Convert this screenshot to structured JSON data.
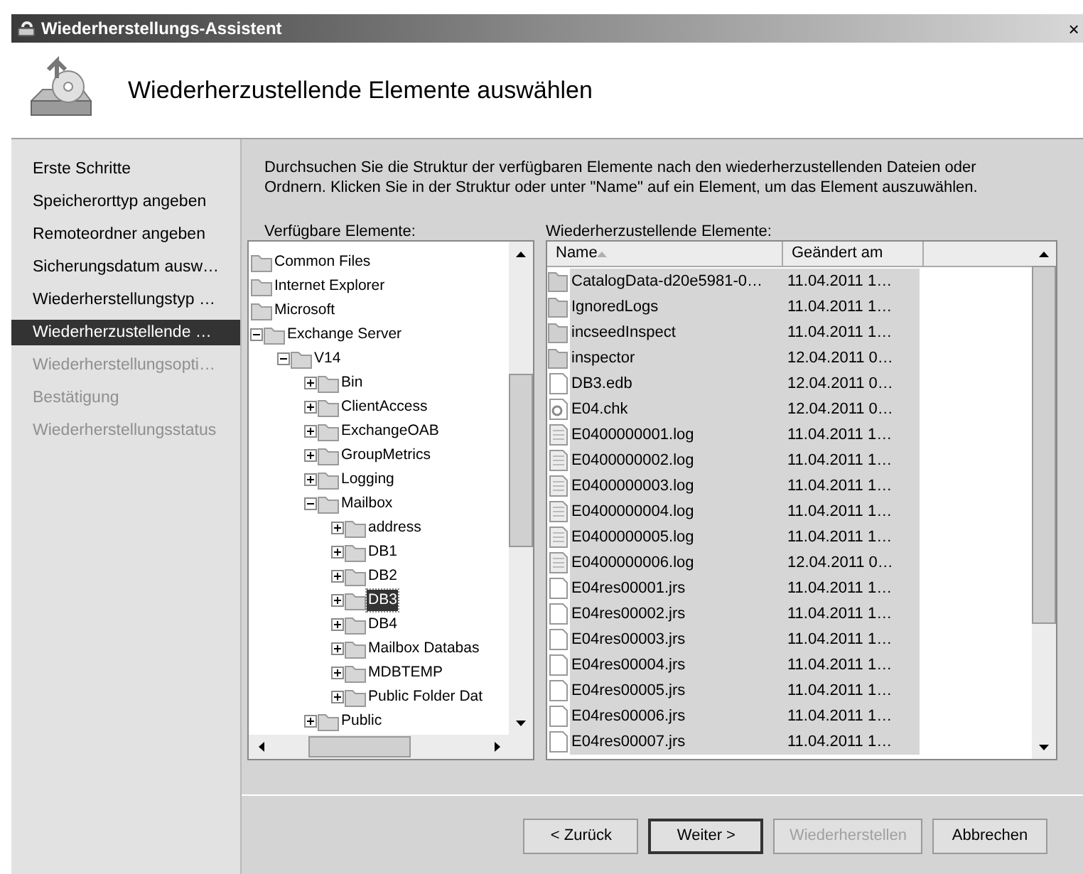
{
  "window": {
    "title": "Wiederherstellungs-Assistent",
    "close": "×"
  },
  "header": {
    "title": "Wiederherzustellende Elemente auswählen"
  },
  "sidebar": {
    "items": [
      {
        "label": "Erste Schritte",
        "selected": false,
        "disabled": false
      },
      {
        "label": "Speicherorttyp angeben",
        "selected": false,
        "disabled": false
      },
      {
        "label": "Remoteordner angeben",
        "selected": false,
        "disabled": false
      },
      {
        "label": "Sicherungsdatum ausw…",
        "selected": false,
        "disabled": false
      },
      {
        "label": "Wiederherstellungstyp …",
        "selected": false,
        "disabled": false
      },
      {
        "label": "Wiederherzustellende …",
        "selected": true,
        "disabled": false
      },
      {
        "label": "Wiederherstellungsopti…",
        "selected": false,
        "disabled": true
      },
      {
        "label": "Bestätigung",
        "selected": false,
        "disabled": true
      },
      {
        "label": "Wiederherstellungsstatus",
        "selected": false,
        "disabled": true
      }
    ]
  },
  "description": "Durchsuchen Sie die Struktur der verfügbaren Elemente nach den wiederherzustellenden Dateien oder Ordnern. Klicken Sie in der Struktur oder unter \"Name\" auf ein Element, um das Element auszuwählen.",
  "tree": {
    "label": "Verfügbare Elemente:",
    "items": [
      {
        "label": "Common Files",
        "selected": false
      },
      {
        "label": "Internet Explorer",
        "selected": false
      },
      {
        "label": "Microsoft",
        "selected": false
      },
      {
        "label": "Exchange Server",
        "selected": false,
        "expanded": true,
        "children": [
          {
            "label": "V14",
            "selected": false,
            "expanded": true,
            "children": [
              {
                "label": "Bin",
                "selected": false,
                "expanded": false
              },
              {
                "label": "ClientAccess",
                "selected": false,
                "expanded": false
              },
              {
                "label": "ExchangeOAB",
                "selected": false,
                "expanded": false
              },
              {
                "label": "GroupMetrics",
                "selected": false,
                "expanded": false
              },
              {
                "label": "Logging",
                "selected": false,
                "expanded": false
              },
              {
                "label": "Mailbox",
                "selected": false,
                "expanded": true,
                "children": [
                  {
                    "label": "address",
                    "selected": false,
                    "expanded": false
                  },
                  {
                    "label": "DB1",
                    "selected": false,
                    "expanded": false
                  },
                  {
                    "label": "DB2",
                    "selected": false,
                    "expanded": false
                  },
                  {
                    "label": "DB3",
                    "selected": true,
                    "expanded": false
                  },
                  {
                    "label": "DB4",
                    "selected": false,
                    "expanded": false
                  },
                  {
                    "label": "Mailbox Databas",
                    "selected": false,
                    "expanded": false
                  },
                  {
                    "label": "MDBTEMP",
                    "selected": false,
                    "expanded": false
                  },
                  {
                    "label": "Public Folder Dat",
                    "selected": false,
                    "expanded": false
                  }
                ]
              },
              {
                "label": "Public",
                "selected": false,
                "expanded": false
              }
            ]
          }
        ]
      }
    ]
  },
  "list": {
    "label": "Wiederherzustellende Elemente:",
    "columns": [
      {
        "label": "Name",
        "sorted": true
      },
      {
        "label": "Geändert am",
        "sorted": false
      }
    ],
    "rows": [
      {
        "kind": "folder",
        "name": "CatalogData-d20e5981-0…",
        "modified": "11.04.2011 1…",
        "selected": true
      },
      {
        "kind": "folder",
        "name": "IgnoredLogs",
        "modified": "11.04.2011 1…",
        "selected": true
      },
      {
        "kind": "folder",
        "name": "incseedInspect",
        "modified": "11.04.2011 1…",
        "selected": true
      },
      {
        "kind": "folder",
        "name": "inspector",
        "modified": "12.04.2011 0…",
        "selected": true
      },
      {
        "kind": "file",
        "name": "DB3.edb",
        "modified": "12.04.2011 0…",
        "selected": true
      },
      {
        "kind": "config",
        "name": "E04.chk",
        "modified": "12.04.2011 0…",
        "selected": true
      },
      {
        "kind": "log",
        "name": "E0400000001.log",
        "modified": "11.04.2011 1…",
        "selected": true
      },
      {
        "kind": "log",
        "name": "E0400000002.log",
        "modified": "11.04.2011 1…",
        "selected": true
      },
      {
        "kind": "log",
        "name": "E0400000003.log",
        "modified": "11.04.2011 1…",
        "selected": true
      },
      {
        "kind": "log",
        "name": "E0400000004.log",
        "modified": "11.04.2011 1…",
        "selected": true
      },
      {
        "kind": "log",
        "name": "E0400000005.log",
        "modified": "11.04.2011 1…",
        "selected": true
      },
      {
        "kind": "log",
        "name": "E0400000006.log",
        "modified": "12.04.2011 0…",
        "selected": true
      },
      {
        "kind": "file",
        "name": "E04res00001.jrs",
        "modified": "11.04.2011 1…",
        "selected": true
      },
      {
        "kind": "file",
        "name": "E04res00002.jrs",
        "modified": "11.04.2011 1…",
        "selected": true
      },
      {
        "kind": "file",
        "name": "E04res00003.jrs",
        "modified": "11.04.2011 1…",
        "selected": true
      },
      {
        "kind": "file",
        "name": "E04res00004.jrs",
        "modified": "11.04.2011 1…",
        "selected": true
      },
      {
        "kind": "file",
        "name": "E04res00005.jrs",
        "modified": "11.04.2011 1…",
        "selected": true
      },
      {
        "kind": "file",
        "name": "E04res00006.jrs",
        "modified": "11.04.2011 1…",
        "selected": true
      },
      {
        "kind": "file",
        "name": "E04res00007.jrs",
        "modified": "11.04.2011 1…",
        "selected": true
      }
    ]
  },
  "buttons": [
    {
      "label": "< Zurück",
      "disabled": false,
      "default": false
    },
    {
      "label": "Weiter >",
      "disabled": false,
      "default": true
    },
    {
      "label": "Wiederherstellen",
      "disabled": true,
      "default": false
    },
    {
      "label": "Abbrechen",
      "disabled": false,
      "default": false
    }
  ]
}
